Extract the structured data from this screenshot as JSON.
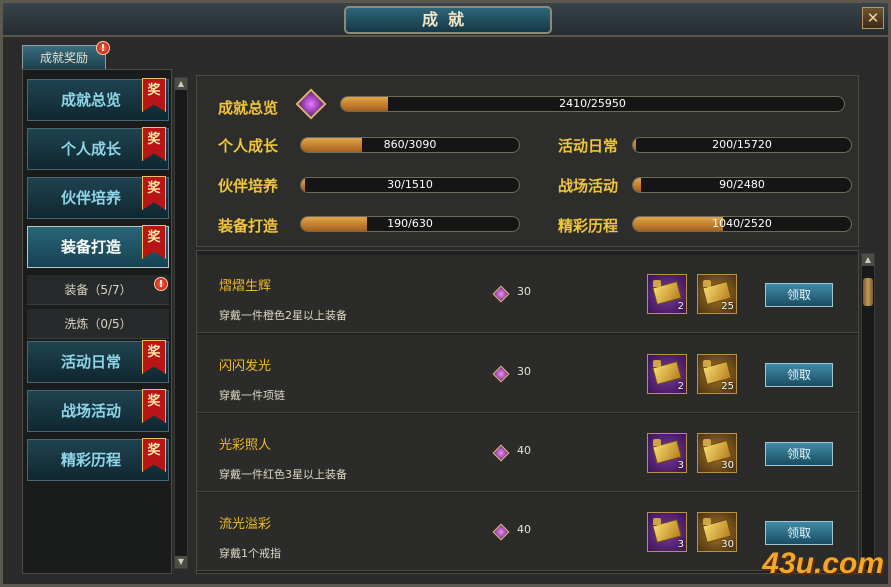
{
  "window": {
    "title": "成就",
    "close_label": "✕"
  },
  "tab": {
    "label": "成就奖励",
    "alert": "!"
  },
  "ribbon_label": "奖",
  "categories": [
    {
      "label": "成就总览"
    },
    {
      "label": "个人成长"
    },
    {
      "label": "伙伴培养"
    },
    {
      "label": "装备打造"
    },
    {
      "label": "活动日常"
    },
    {
      "label": "战场活动"
    },
    {
      "label": "精彩历程"
    }
  ],
  "subcategories": [
    {
      "label": "装备（5/7）",
      "alert": "!"
    },
    {
      "label": "洗炼（0/5）"
    }
  ],
  "overview": {
    "total": {
      "label": "成就总览",
      "text": "2410/25950",
      "progress": 0.093
    },
    "items": [
      {
        "label": "个人成长",
        "text": "860/3090",
        "progress": 0.278
      },
      {
        "label": "活动日常",
        "text": "200/15720",
        "progress": 0.013
      },
      {
        "label": "伙伴培养",
        "text": "30/1510",
        "progress": 0.02
      },
      {
        "label": "战场活动",
        "text": "90/2480",
        "progress": 0.036
      },
      {
        "label": "装备打造",
        "text": "190/630",
        "progress": 0.302
      },
      {
        "label": "精彩历程",
        "text": "1040/2520",
        "progress": 0.413
      }
    ]
  },
  "achievements": [
    {
      "name": "熠熠生辉",
      "desc": "穿戴一件橙色2星以上装备",
      "points": "30",
      "reward1": "2",
      "reward2": "25",
      "claim": "领取"
    },
    {
      "name": "闪闪发光",
      "desc": "穿戴一件项链",
      "points": "30",
      "reward1": "2",
      "reward2": "25",
      "claim": "领取"
    },
    {
      "name": "光彩照人",
      "desc": "穿戴一件红色3星以上装备",
      "points": "40",
      "reward1": "3",
      "reward2": "30",
      "claim": "领取"
    },
    {
      "name": "流光溢彩",
      "desc": "穿戴1个戒指",
      "points": "40",
      "reward1": "3",
      "reward2": "30",
      "claim": "领取"
    }
  ],
  "watermark": "43u.com",
  "colors": {
    "accent_gold": "#f0c43c",
    "button_teal": "#2a6577",
    "ribbon_red": "#b81616",
    "progress_fill": "#d0913a"
  }
}
